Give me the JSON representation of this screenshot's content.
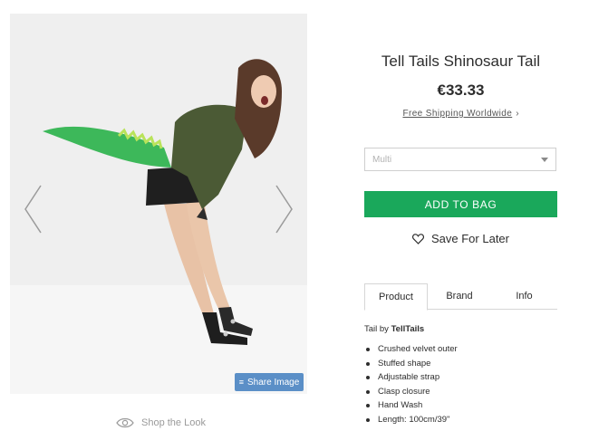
{
  "product": {
    "title": "Tell Tails Shinosaur Tail",
    "price": "€33.33",
    "shipping_link": "Free Shipping Worldwide",
    "shipping_chevron": "›"
  },
  "gallery": {
    "share_label": "Share Image",
    "share_icon": "stack-icon",
    "prev_icon": "chevron-left-icon",
    "next_icon": "chevron-right-icon",
    "shop_look_label": "Shop the Look",
    "shop_look_icon": "eye-icon"
  },
  "options": {
    "color_select_value": "Multi"
  },
  "actions": {
    "add_to_bag": "ADD TO BAG",
    "save_for_later": "Save For Later",
    "save_icon": "heart-icon"
  },
  "tabs": [
    "Product",
    "Brand",
    "Info"
  ],
  "description": {
    "by_prefix": "Tail by ",
    "brand": "TellTails",
    "bullets": [
      "Crushed velvet outer",
      "Stuffed shape",
      "Adjustable strap",
      "Clasp closure",
      "Hand Wash",
      "Length: 100cm/39\""
    ]
  },
  "colors": {
    "accent_green": "#1aa85b",
    "share_blue": "#5b8fc7",
    "tail_green": "#3db85a"
  }
}
